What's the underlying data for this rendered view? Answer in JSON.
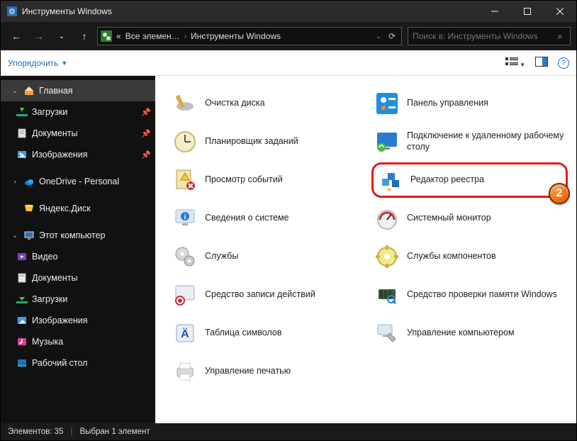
{
  "window": {
    "title": "Инструменты Windows"
  },
  "address": {
    "crumb1": "Все элемен…",
    "crumb2": "Инструменты Windows"
  },
  "search": {
    "placeholder": "Поиск в: Инструменты Windows"
  },
  "toolbar": {
    "organize": "Упорядочить"
  },
  "nav": {
    "home": "Главная",
    "downloads": "Загрузки",
    "documents": "Документы",
    "pictures": "Изображения",
    "onedrive": "OneDrive - Personal",
    "yandex": "Яндекс.Диск",
    "thispc": "Этот компьютер",
    "video": "Видео",
    "documents2": "Документы",
    "downloads2": "Загрузки",
    "pictures2": "Изображения",
    "music": "Музыка",
    "desktop": "Рабочий стол"
  },
  "items": {
    "c0": {
      "label": "Очистка диска"
    },
    "c1": {
      "label": "Панель управления"
    },
    "c2": {
      "label": "Планировщик заданий"
    },
    "c3": {
      "label": "Подключение к удаленному рабочему столу"
    },
    "c4": {
      "label": "Просмотр событий"
    },
    "c5": {
      "label": "Редактор реестра"
    },
    "c6": {
      "label": "Сведения о системе"
    },
    "c7": {
      "label": "Системный монитор"
    },
    "c8": {
      "label": "Службы"
    },
    "c9": {
      "label": "Службы компонентов"
    },
    "c10": {
      "label": "Средство записи действий"
    },
    "c11": {
      "label": "Средство проверки памяти Windows"
    },
    "c12": {
      "label": "Таблица символов"
    },
    "c13": {
      "label": "Управление компьютером"
    },
    "c14": {
      "label": "Управление печатью"
    }
  },
  "callout": {
    "num": "2"
  },
  "status": {
    "count": "Элементов: 35",
    "selected": "Выбран 1 элемент"
  }
}
